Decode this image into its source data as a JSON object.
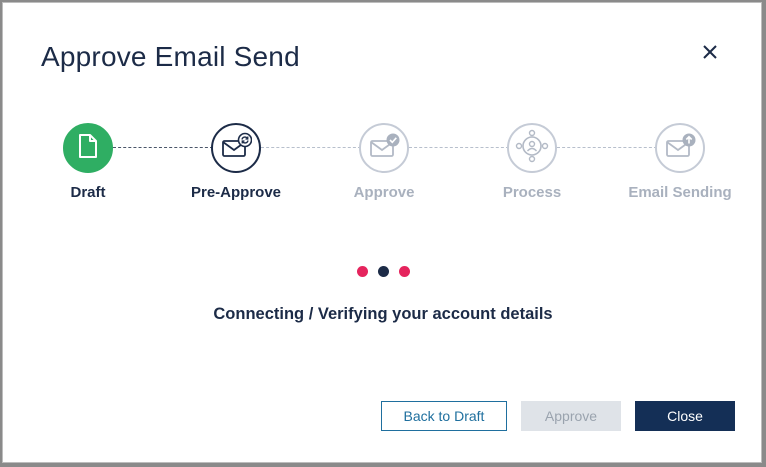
{
  "dialog": {
    "title": "Approve Email Send",
    "close_icon": "close-icon"
  },
  "steps": [
    {
      "label": "Draft",
      "state": "complete",
      "icon": "document-icon"
    },
    {
      "label": "Pre-Approve",
      "state": "current",
      "icon": "email-refresh-icon"
    },
    {
      "label": "Approve",
      "state": "pending",
      "icon": "email-check-icon"
    },
    {
      "label": "Process",
      "state": "pending",
      "icon": "process-hub-icon"
    },
    {
      "label": "Email Sending",
      "state": "pending",
      "icon": "email-upload-icon"
    }
  ],
  "loader": {
    "dot_colors": [
      "#e5245d",
      "#1c2b47",
      "#e5245d"
    ]
  },
  "status": {
    "message": "Connecting / Verifying your account details"
  },
  "buttons": {
    "back_label": "Back to Draft",
    "approve_label": "Approve",
    "close_label": "Close"
  },
  "colors": {
    "complete": "#2fae63",
    "navy": "#1c2b47",
    "pending": "#c5cbd6",
    "link_blue": "#1f6f9e",
    "accent_pink": "#e5245d"
  }
}
